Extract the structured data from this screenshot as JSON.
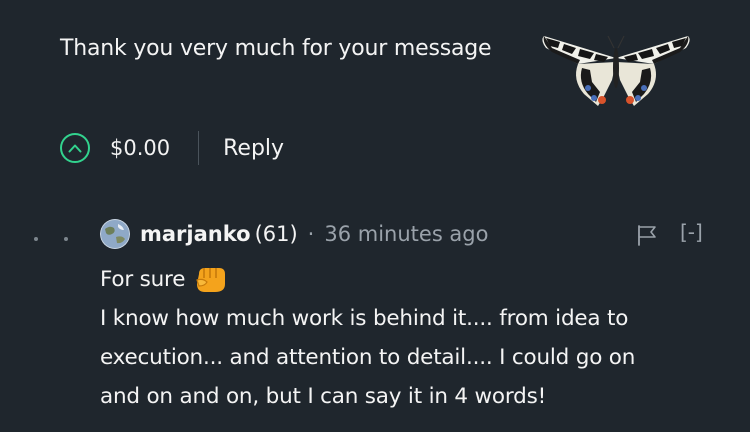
{
  "parent": {
    "message": "Thank you very much for your message",
    "payout": "$0.00",
    "reply_label": "Reply"
  },
  "comment": {
    "author": "marjanko",
    "reputation": "(61)",
    "separator": "·",
    "time": "36 minutes ago",
    "collapse_label": "[-]",
    "lines": [
      "For sure",
      "I know how much work is behind it.... from idea to",
      "execution... and attention to detail.... I could go on",
      "and on and on, but I can say it in 4 words!"
    ]
  },
  "colors": {
    "background": "#1f262d",
    "upvote_accent": "#32d38e",
    "muted_text": "#9aa2aa"
  },
  "icons": {
    "upvote": "chevron-up-circle-icon",
    "flag": "flag-icon",
    "avatar": "earth-avatar",
    "emoji": "fist-bump-emoji",
    "image": "butterfly-image"
  }
}
